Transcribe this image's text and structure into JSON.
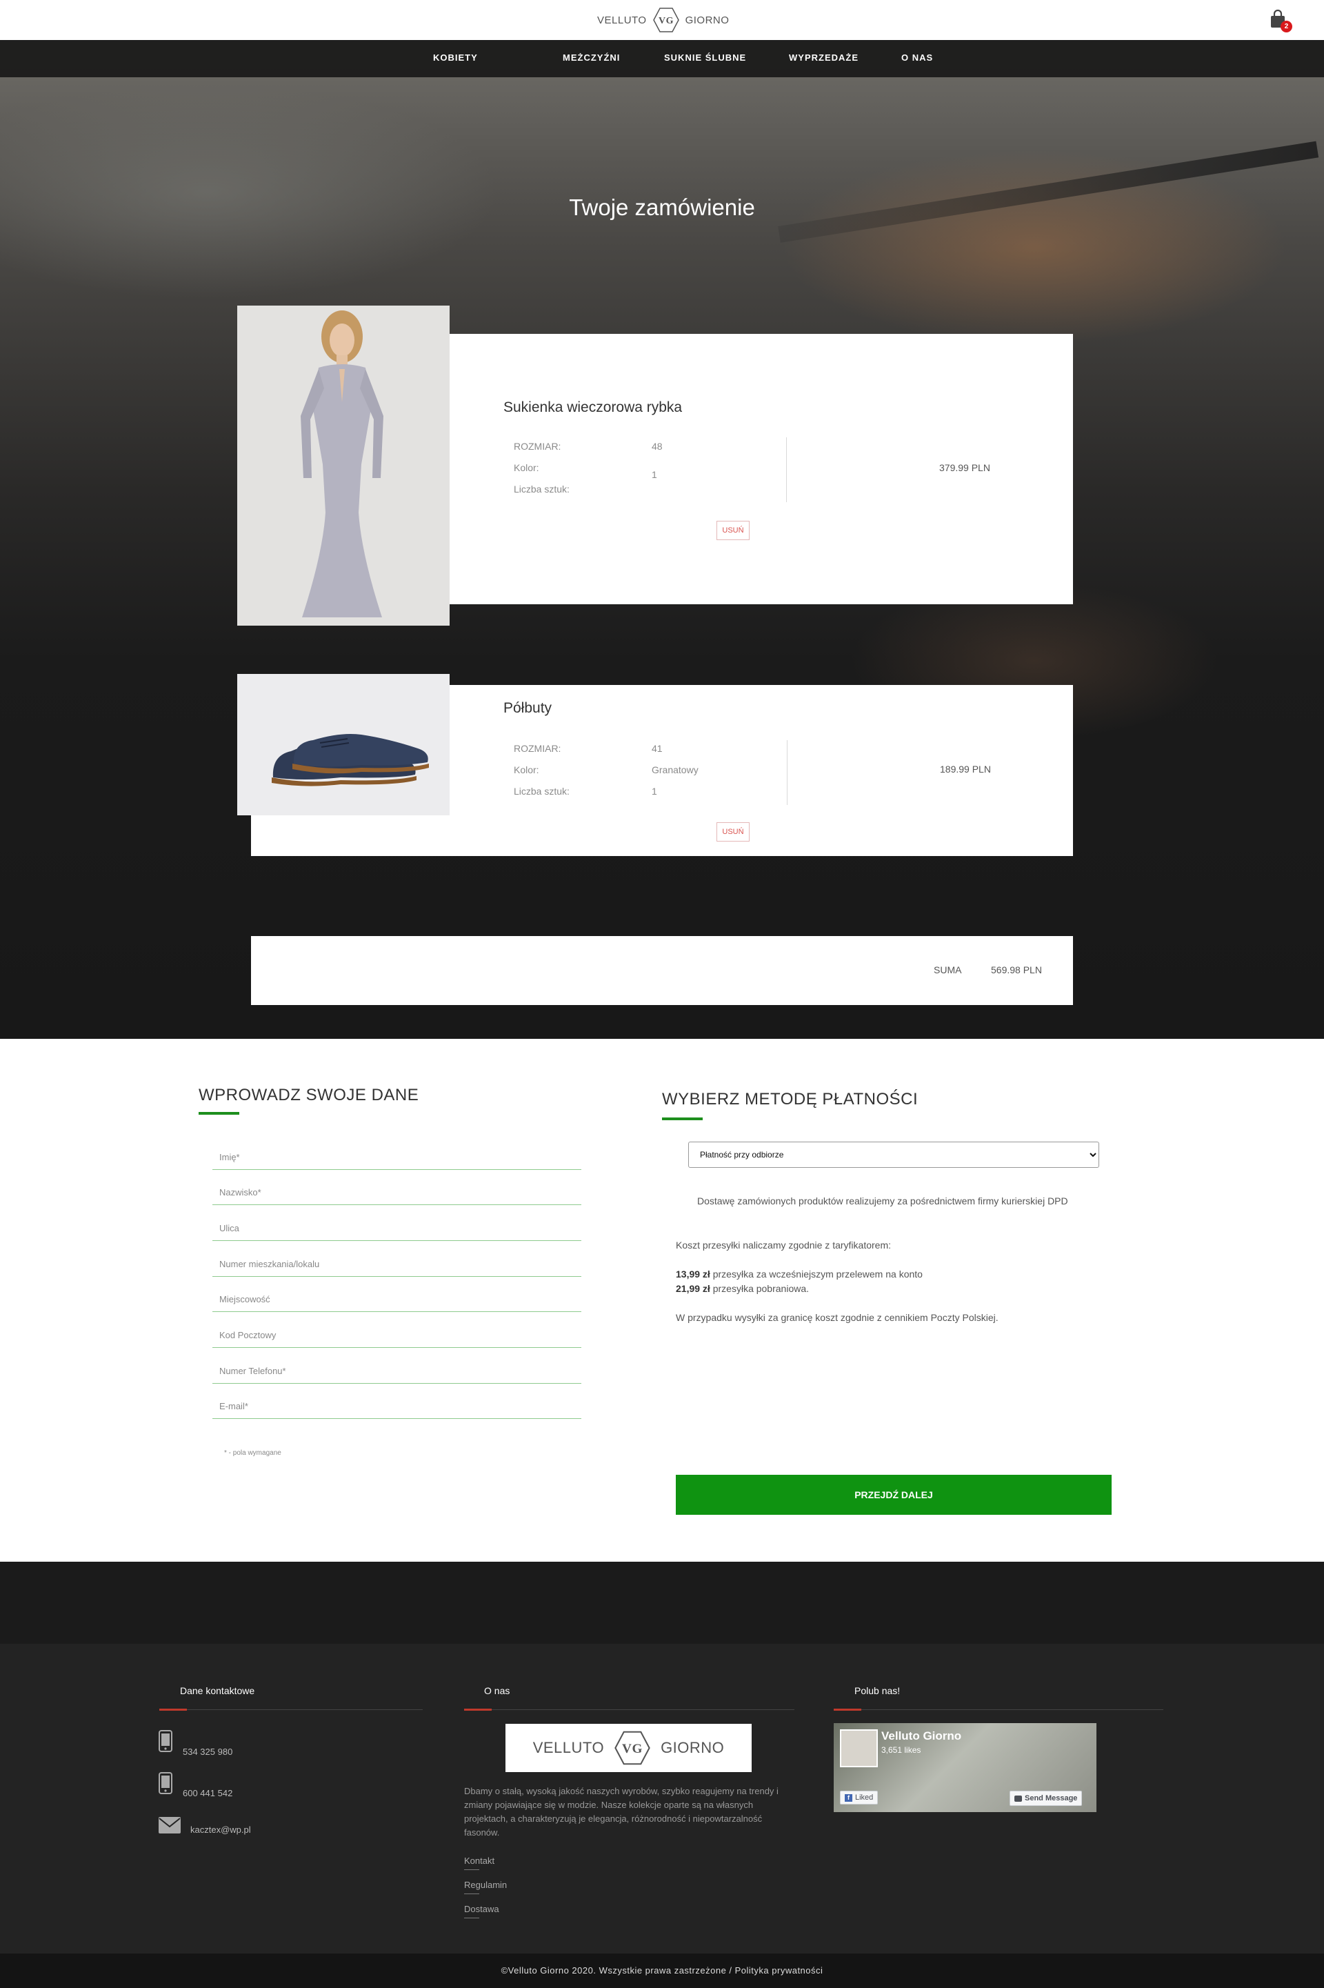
{
  "brand": {
    "left": "VELLUTO",
    "monogram": "VG",
    "right": "GIORNO"
  },
  "cart": {
    "count": "2"
  },
  "nav": [
    "KOBIETY",
    "MEŻCZYŹNI",
    "SUKNIE ŚLUBNE",
    "WYPRZEDAŻE",
    "O NAS"
  ],
  "hero": {
    "title": "Twoje zamówienie"
  },
  "labels": {
    "size": "ROZMIAR:",
    "color": "Kolor:",
    "qty": "Liczba sztuk:",
    "remove": "USUŃ"
  },
  "items": [
    {
      "name": "Sukienka wieczorowa rybka",
      "size": "48",
      "color": "",
      "qty": "1",
      "price": "379.99 PLN"
    },
    {
      "name": "Półbuty",
      "size": "41",
      "color": "Granatowy",
      "qty": "1",
      "price": "189.99 PLN"
    }
  ],
  "summary": {
    "label": "SUMA",
    "value": "569.98 PLN"
  },
  "form": {
    "title": "WPROWADZ SWOJE DANE",
    "fields": [
      "Imię*",
      "Nazwisko*",
      "Ulica",
      "Numer mieszkania/lokalu",
      "Miejscowość",
      "Kod Pocztowy",
      "Numer Telefonu*",
      "E-mail*"
    ],
    "required_note": "* - pola wymagane"
  },
  "payment": {
    "title": "WYBIERZ METODĘ PŁATNOŚCI",
    "selected": "Płatność przy odbiorze",
    "delivery_info": "Dostawę zamówionych produktów realizujemy za pośrednictwem firmy kurierskiej DPD",
    "shipping_intro": "Koszt przesyłki naliczamy zgodnie z taryfikatorem:",
    "rate1_amount": "13,99 zł",
    "rate1_text": "przesyłka za wcześniejszym przelewem na konto",
    "rate2_amount": "21,99 zł",
    "rate2_text": "przesyłka pobraniowa.",
    "abroad": "W przypadku wysyłki za granicę koszt zgodnie z cennikiem Poczty Polskiej.",
    "next_label": "PRZEJDŹ DALEJ"
  },
  "footer": {
    "contact_title": "Dane kontaktowe",
    "phone1": "534 325 980",
    "phone2": "600 441 542",
    "email": "kacztex@wp.pl",
    "about_title": "O nas",
    "about_text": "Dbamy o stałą, wysoką jakość naszych wyrobów, szybko reagujemy na trendy i zmiany pojawiające się w modzie. Nasze kolekcje oparte są na własnych projektach, a charakteryzują je elegancja, różnorodność i niepowtarzalność fasonów.",
    "links": [
      "Kontakt",
      "Regulamin",
      "Dostawa"
    ],
    "like_title": "Polub nas!",
    "fb_name": "Velluto Giorno",
    "fb_likes": "3,651 likes",
    "fb_liked": "Liked",
    "fb_message": "Send Message",
    "copyright": "©Velluto Giorno 2020. Wszystkie prawa zastrzeżone / Polityka prywatności"
  },
  "colors": {
    "accent_green": "#0f9311",
    "badge_red": "#d9191c",
    "footer_red": "#c0392b"
  }
}
